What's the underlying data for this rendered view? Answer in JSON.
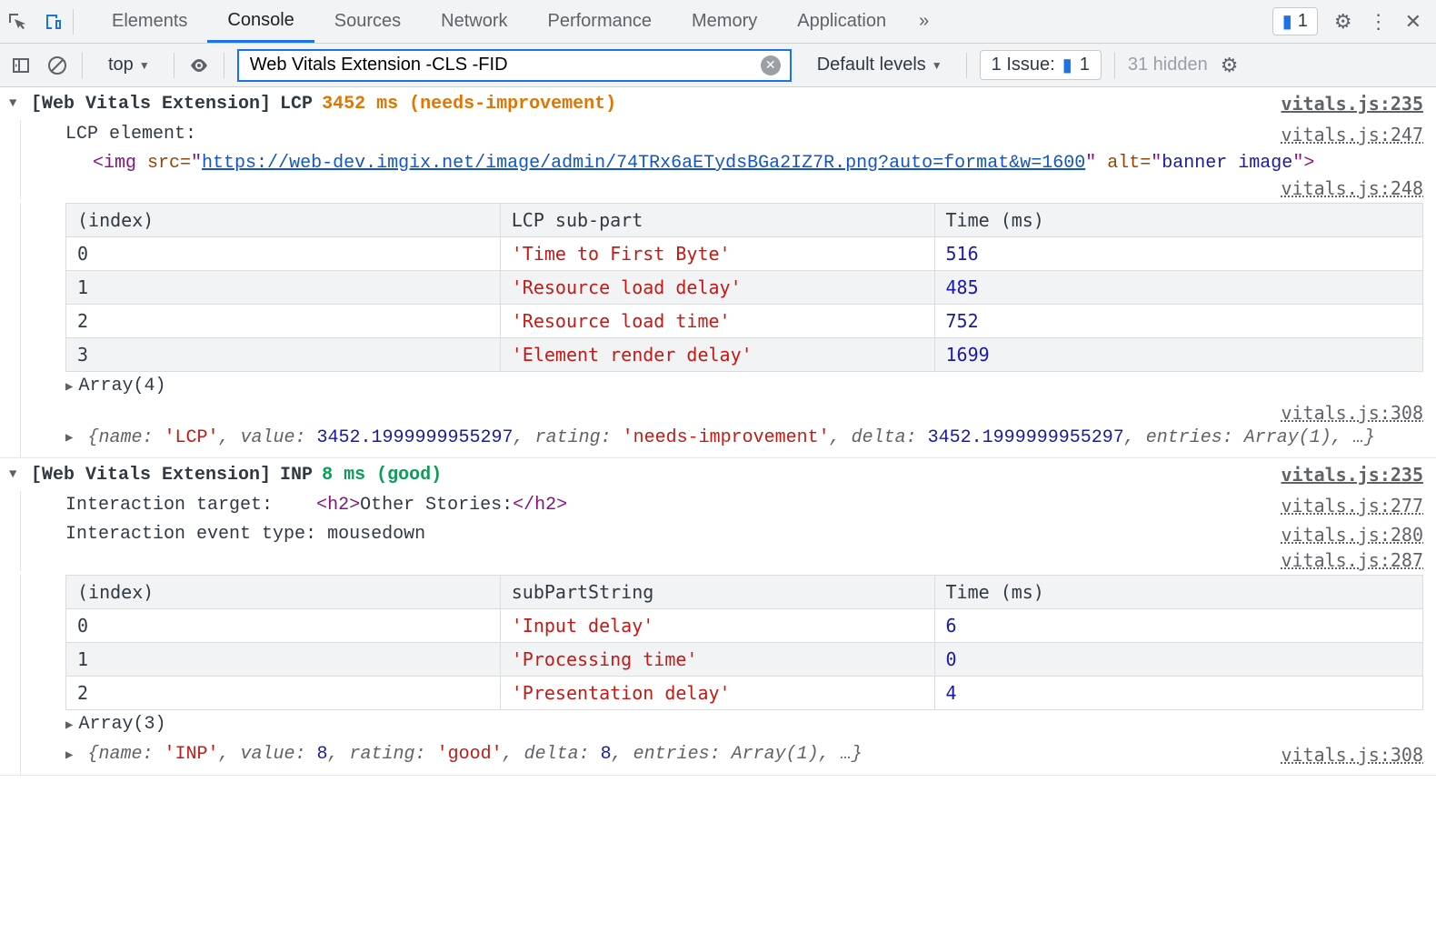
{
  "tabs": [
    "Elements",
    "Console",
    "Sources",
    "Network",
    "Performance",
    "Memory",
    "Application"
  ],
  "active_tab": "Console",
  "msg_badge": "1",
  "toolbar": {
    "context": "top",
    "filter_value": "Web Vitals Extension -CLS -FID",
    "levels_label": "Default levels",
    "issues_prefix": "1 Issue:",
    "issues_count": "1",
    "hidden_label": "31 hidden"
  },
  "lcp": {
    "prefix": "[Web Vitals Extension]",
    "metric": "LCP",
    "value_line": "3452 ms (needs-improvement)",
    "src_header": "vitals.js:235",
    "elt_label": "LCP element:",
    "elt_src": "vitals.js:247",
    "img_src": "https://web-dev.imgix.net/image/admin/74TRx6aETydsBGa2IZ7R.png?auto=format&w=1600",
    "img_alt": "banner image",
    "table_src": "vitals.js:248",
    "headers": [
      "(index)",
      "LCP sub-part",
      "Time (ms)"
    ],
    "rows": [
      [
        "0",
        "'Time to First Byte'",
        "516"
      ],
      [
        "1",
        "'Resource load delay'",
        "485"
      ],
      [
        "2",
        "'Resource load time'",
        "752"
      ],
      [
        "3",
        "'Element render delay'",
        "1699"
      ]
    ],
    "array_label": "Array(4)",
    "obj_src": "vitals.js:308",
    "obj": {
      "name": "'LCP'",
      "value": "3452.1999999955297",
      "rating": "'needs-improvement'",
      "delta": "3452.1999999955297",
      "entries": "Array(1)",
      "more": "…"
    }
  },
  "inp": {
    "prefix": "[Web Vitals Extension]",
    "metric": "INP",
    "value_line": "8 ms (good)",
    "src_header": "vitals.js:235",
    "target_label": "Interaction target:",
    "target_html_tag": "h2",
    "target_html_text": "Other Stories:",
    "target_src": "vitals.js:277",
    "evt_label": "Interaction event type:",
    "evt_value": "mousedown",
    "evt_src": "vitals.js:280",
    "table_src": "vitals.js:287",
    "headers": [
      "(index)",
      "subPartString",
      "Time (ms)"
    ],
    "rows": [
      [
        "0",
        "'Input delay'",
        "6"
      ],
      [
        "1",
        "'Processing time'",
        "0"
      ],
      [
        "2",
        "'Presentation delay'",
        "4"
      ]
    ],
    "array_label": "Array(3)",
    "obj_src": "vitals.js:308",
    "obj": {
      "name": "'INP'",
      "value": "8",
      "rating": "'good'",
      "delta": "8",
      "entries": "Array(1)",
      "more": "…"
    }
  }
}
